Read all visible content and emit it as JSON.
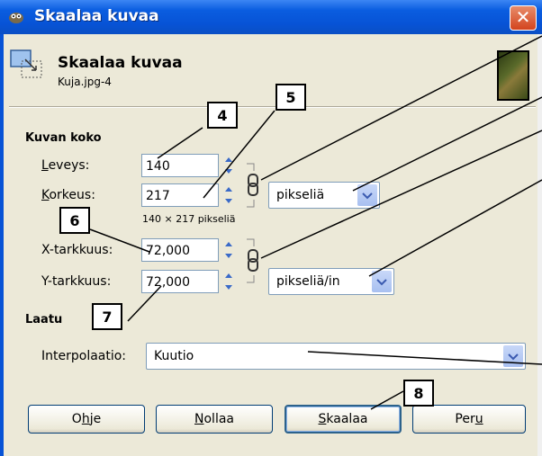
{
  "window": {
    "title": "Skaalaa kuvaa",
    "close_glyph": "✕"
  },
  "header": {
    "title": "Skaalaa kuvaa",
    "subtitle": "Kuja.jpg-4",
    "icon": "scale-image-icon",
    "thumbnail": "image-thumbnail"
  },
  "image_size": {
    "section_label": "Kuvan koko",
    "width": {
      "label_u": "L",
      "label_rest": "eveys:",
      "value": "140"
    },
    "height": {
      "label_u": "K",
      "label_rest": "orkeus:",
      "value": "217"
    },
    "dims_text": "140 × 217 pikseliä",
    "unit": "pikseliä",
    "x_res": {
      "label": "X-tarkkuus:",
      "value": "72,000"
    },
    "y_res": {
      "label": "Y-tarkkuus:",
      "value": "72,000"
    },
    "res_unit": "pikseliä/in"
  },
  "quality": {
    "section_label": "Laatu",
    "interp_label": "Interpolaatio:",
    "interp_value": "Kuutio"
  },
  "buttons": {
    "help": {
      "pre": "O",
      "u": "h",
      "post": "je"
    },
    "reset": {
      "pre": "",
      "u": "N",
      "post": "ollaa"
    },
    "scale": {
      "pre": "",
      "u": "S",
      "post": "kaalaa"
    },
    "cancel": {
      "pre": "Per",
      "u": "u",
      "post": ""
    }
  },
  "callouts": [
    "4",
    "5",
    "6",
    "7",
    "8"
  ],
  "colors": {
    "titlebar": "#0753d6",
    "dialog_bg": "#ece9d8",
    "close": "#d3441e",
    "field_border": "#7f9db9"
  }
}
